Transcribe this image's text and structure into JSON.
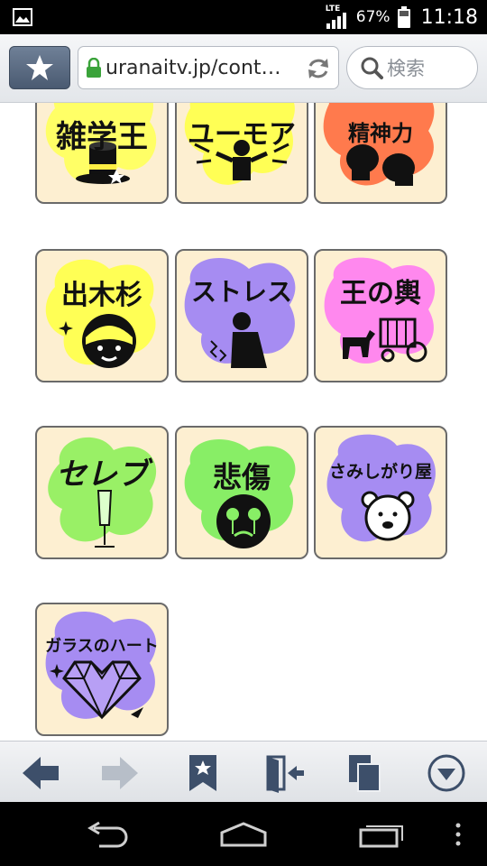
{
  "status_bar": {
    "network": "LTE",
    "battery_percent": "67%",
    "time": "11:18"
  },
  "browser": {
    "url": "uranaitv.jp/cont…",
    "search_placeholder": "検索"
  },
  "tiles": [
    {
      "label": "雑学王",
      "bg": "#ffff66"
    },
    {
      "label": "ユーモア",
      "bg": "#ffff55"
    },
    {
      "label": "精神力",
      "bg": "#ff7a4d"
    },
    {
      "label": "出木杉",
      "bg": "#ffff55"
    },
    {
      "label": "ストレス",
      "bg": "#a68cf2"
    },
    {
      "label": "王の輿",
      "bg": "#ff88ee"
    },
    {
      "label": "セレブ",
      "bg": "#99f066"
    },
    {
      "label": "悲傷",
      "bg": "#88ee66"
    },
    {
      "label": "さみしがり屋",
      "bg": "#a68cf2"
    },
    {
      "label": "ガラスのハート",
      "bg": "#a68cf2"
    }
  ]
}
